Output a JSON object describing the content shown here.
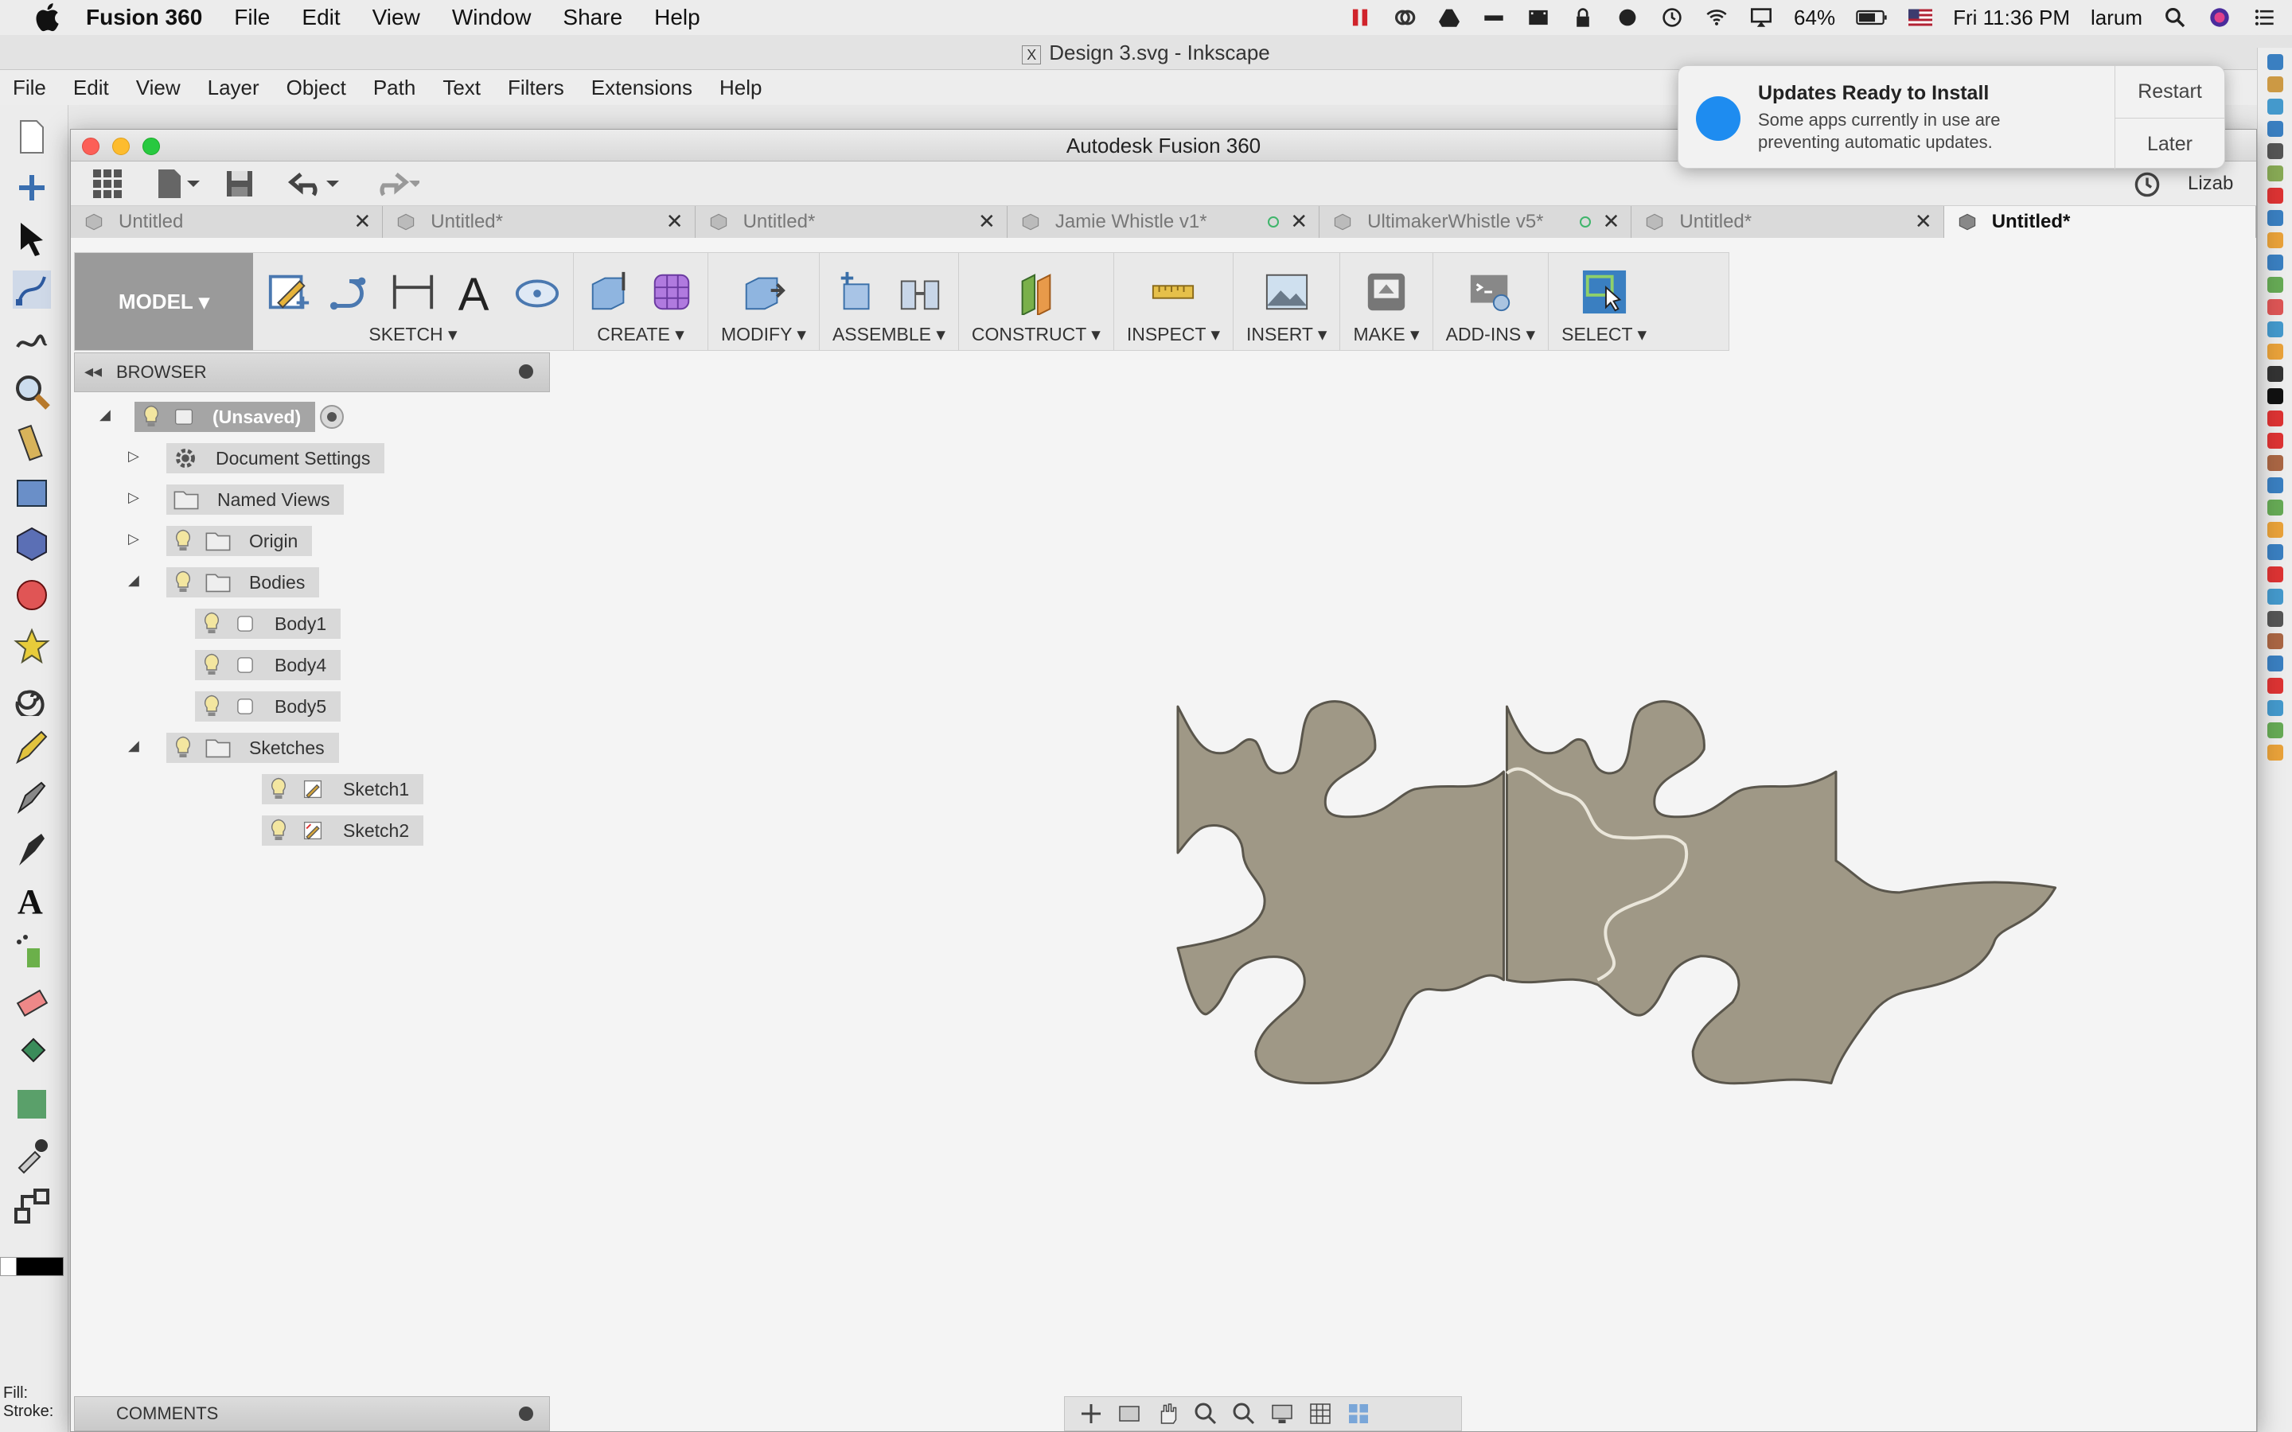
{
  "menubar": {
    "app_name": "Fusion 360",
    "items": [
      "File",
      "Edit",
      "View",
      "Window",
      "Share",
      "Help"
    ],
    "battery": "64%",
    "clock": "Fri 11:36 PM",
    "user": "larum"
  },
  "inkscape": {
    "window_title": "Design 3.svg - Inkscape",
    "menu": [
      "File",
      "Edit",
      "View",
      "Layer",
      "Object",
      "Path",
      "Text",
      "Filters",
      "Extensions",
      "Help"
    ],
    "fill_label": "Fill:",
    "stroke_label": "Stroke:"
  },
  "fusion": {
    "window_title": "Autodesk Fusion 360",
    "user_partial": "Lizab",
    "tabs": [
      {
        "label": "Untitled",
        "active": false
      },
      {
        "label": "Untitled*",
        "active": false
      },
      {
        "label": "Untitled*",
        "active": false
      },
      {
        "label": "Jamie Whistle v1*",
        "active": false
      },
      {
        "label": "UltimakerWhistle v5*",
        "active": false
      },
      {
        "label": "Untitled*",
        "active": false
      },
      {
        "label": "Untitled*",
        "active": true
      }
    ],
    "toolbar": {
      "workspace": "MODEL",
      "groups": [
        "SKETCH",
        "CREATE",
        "MODIFY",
        "ASSEMBLE",
        "CONSTRUCT",
        "INSPECT",
        "INSERT",
        "MAKE",
        "ADD-INS",
        "SELECT"
      ]
    },
    "browser": {
      "title": "BROWSER",
      "root": "(Unsaved)",
      "document_settings": "Document Settings",
      "named_views": "Named Views",
      "origin": "Origin",
      "bodies": "Bodies",
      "body_items": [
        "Body1",
        "Body4",
        "Body5"
      ],
      "sketches": "Sketches",
      "sketch_items": [
        "Sketch1",
        "Sketch2"
      ]
    },
    "comments": "COMMENTS"
  },
  "notification": {
    "title": "Updates Ready to Install",
    "body": "Some apps currently in use are preventing automatic updates.",
    "restart": "Restart",
    "later": "Later"
  },
  "colors": {
    "puzzle_fill": "#9f9886",
    "puzzle_stroke": "#5a564c",
    "select_blue": "#3a7fc1"
  }
}
